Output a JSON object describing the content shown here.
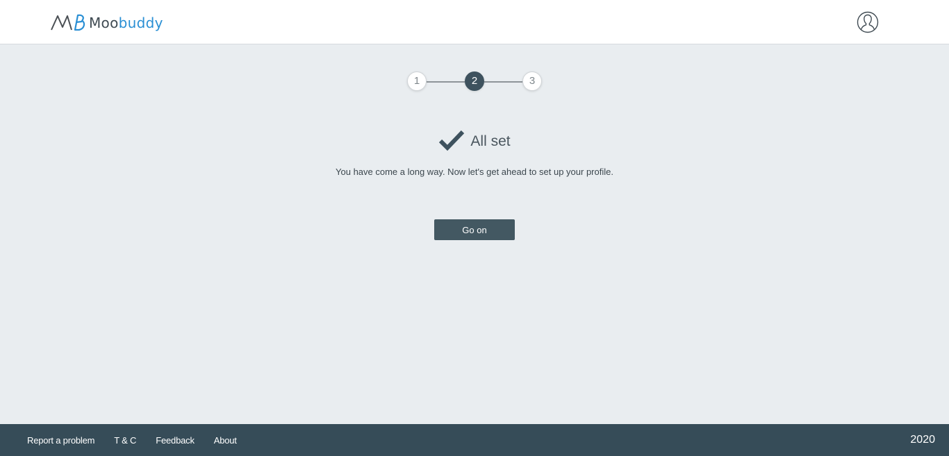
{
  "header": {
    "brand": {
      "part1": "Moo",
      "part2": "buddy"
    },
    "logo_icon": "mb-logo-mark",
    "avatar_icon": "user-avatar-icon"
  },
  "stepper": {
    "steps": [
      {
        "label": "1",
        "state": "inactive"
      },
      {
        "label": "2",
        "state": "active"
      },
      {
        "label": "3",
        "state": "inactive"
      }
    ],
    "current_step": 2
  },
  "main": {
    "icon": "checkmark-icon",
    "title": "All set",
    "subtitle": "You have come a long way. Now let's get ahead to set up your profile.",
    "button_label": "Go on"
  },
  "footer": {
    "links": [
      "Report a problem",
      "T & C",
      "Feedback",
      "About"
    ],
    "year": "2020"
  },
  "colors": {
    "page_bg": "#e9edf0",
    "accent_dark": "#3e525e",
    "button_bg": "#435862",
    "footer_bg": "#364c58",
    "brand_blue": "#2a8fd4"
  }
}
